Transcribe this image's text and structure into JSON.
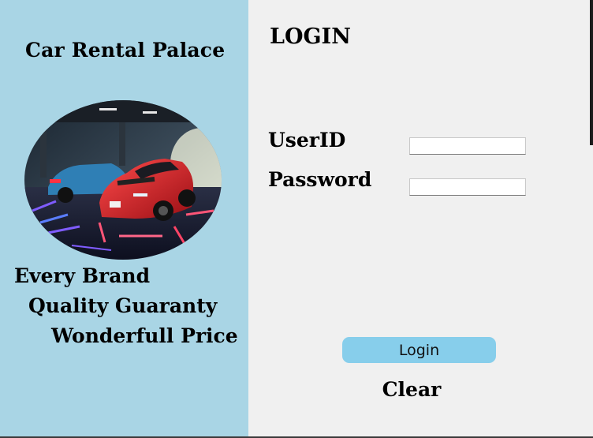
{
  "brand": {
    "title": "Car Rental Palace",
    "image_icon": "sports-car-photo"
  },
  "slogans": [
    "Every Brand",
    "Quality Guaranty",
    "Wonderfull Price"
  ],
  "login": {
    "heading": "LOGIN",
    "userid_label": "UserID",
    "userid_value": "",
    "password_label": "Password",
    "password_value": "",
    "login_button": "Login",
    "clear_button": "Clear"
  },
  "colors": {
    "left_panel": "#a9d5e5",
    "right_panel": "#f0f0f0",
    "login_button": "#87ceeb"
  }
}
